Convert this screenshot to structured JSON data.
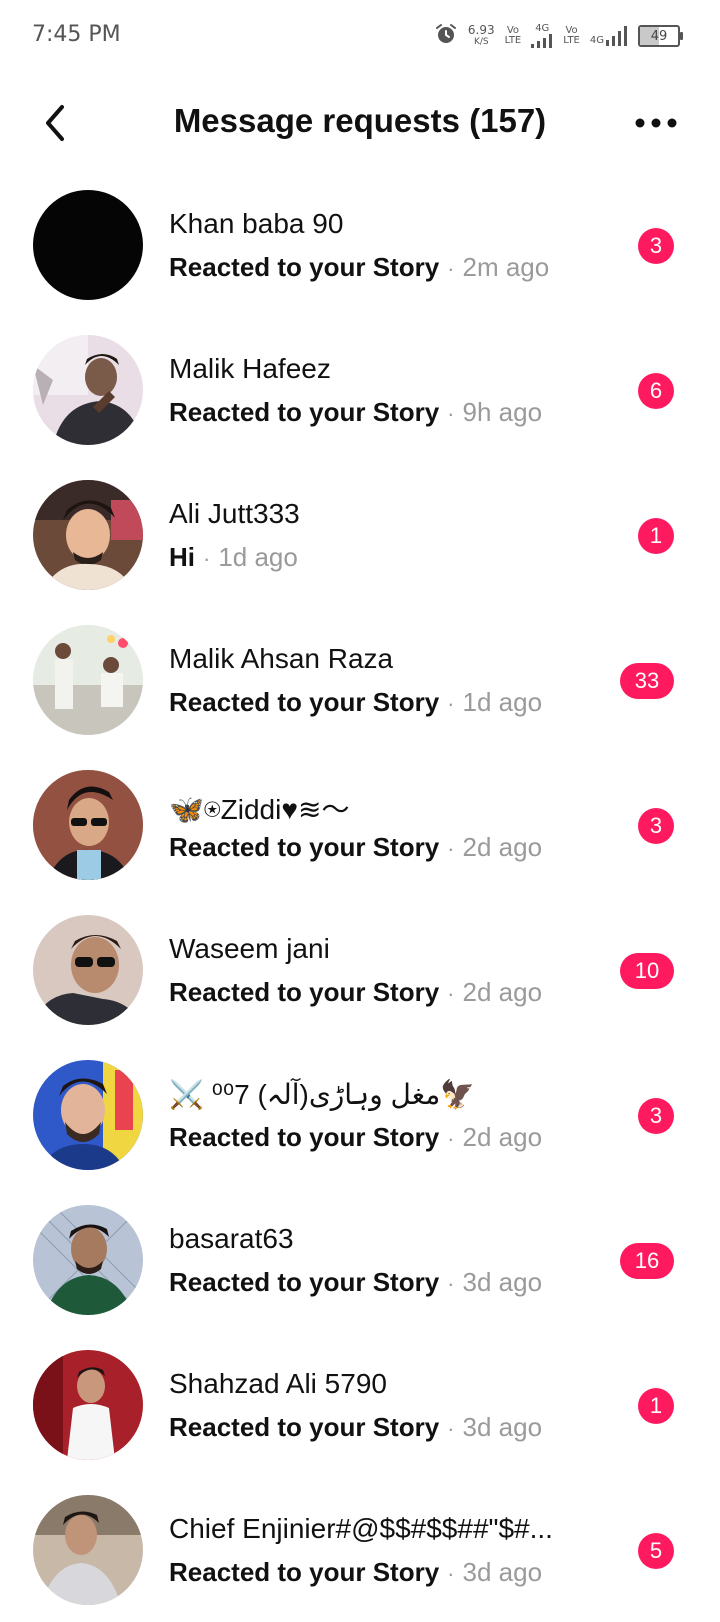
{
  "status_bar": {
    "time": "7:45 PM",
    "speed_value": "6.93",
    "speed_unit": "K/S",
    "sim1_tag_top": "Vo",
    "sim1_tag_bottom": "LTE",
    "sim1_net": "4G",
    "sim2_tag_top": "Vo",
    "sim2_tag_bottom": "LTE",
    "sim2_net": "4G",
    "battery": "49",
    "battery_level_percent": 49,
    "icons": [
      "alarm-icon",
      "signal-icon",
      "battery-icon"
    ]
  },
  "header": {
    "title": "Message requests (157)",
    "back_icon": "chevron-left-icon",
    "more_icon": "more-horizontal-icon"
  },
  "colors": {
    "badge": "#ff1a5f",
    "secondary_text": "#9a9a9a"
  },
  "requests": [
    {
      "name": "Khan baba 90",
      "message": "Reacted to your Story",
      "time": "2m ago",
      "count": "3"
    },
    {
      "name": "Malik Hafeez",
      "message": "Reacted to your Story",
      "time": "9h ago",
      "count": "6"
    },
    {
      "name": "Ali Jutt333",
      "message": "Hi",
      "time": "1d ago",
      "count": "1"
    },
    {
      "name": "Malik Ahsan Raza",
      "message": "Reacted to your Story",
      "time": "1d ago",
      "count": "33"
    },
    {
      "name": "🦋⍟Ziddi♥︎≋〜",
      "message": "Reacted to your Story",
      "time": "2d ago",
      "count": "3"
    },
    {
      "name": "Waseem jani",
      "message": "Reacted to your Story",
      "time": "2d ago",
      "count": "10"
    },
    {
      "name": "⚔️ ⁰⁰7 (آلہ)مغل وہاڑی🦅",
      "message": "Reacted to your Story",
      "time": "2d ago",
      "count": "3"
    },
    {
      "name": "basarat63",
      "message": "Reacted to your Story",
      "time": "3d ago",
      "count": "16"
    },
    {
      "name": "Shahzad Ali 5790",
      "message": "Reacted to your Story",
      "time": "3d ago",
      "count": "1"
    },
    {
      "name": "Chief Enjinier#@$$#$$##\"$#...",
      "message": "Reacted to your Story",
      "time": "3d ago",
      "count": "5"
    }
  ]
}
